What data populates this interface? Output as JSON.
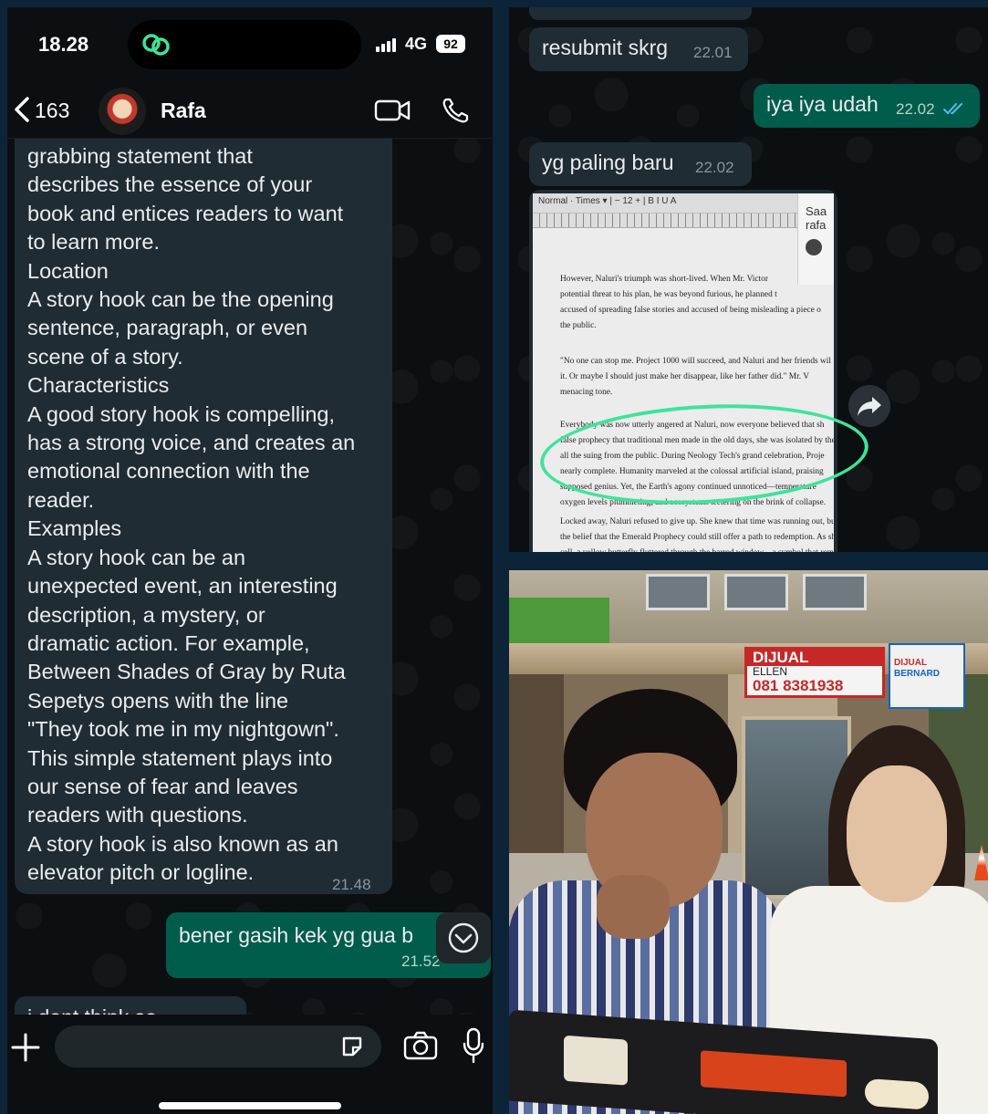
{
  "status_bar": {
    "time": "18.28",
    "network": "4G",
    "battery": "92"
  },
  "header": {
    "back_count": "163",
    "contact_name": "Rafa"
  },
  "messages_left": {
    "long_text_lines": [
      "grabbing statement that",
      "describes the essence of your",
      "book and entices readers to want",
      "to learn more.",
      "Location",
      "A story hook can be the opening",
      "sentence, paragraph, or even",
      "scene of a story.",
      "Characteristics",
      "A good story hook is compelling,",
      "has a strong voice, and creates an",
      "emotional connection with the",
      "reader.",
      "Examples",
      "A story hook can be an",
      "unexpected event, an interesting",
      "description, a mystery, or",
      "dramatic action. For example,",
      "Between Shades of Gray by Ruta",
      "Sepetys opens with the line",
      "\"They took me in my nightgown\".",
      "This simple statement plays into",
      "our sense of fear and leaves",
      "readers with questions.",
      "A story hook is also known as an",
      "elevator pitch or logline."
    ],
    "long_text_time": "21.48",
    "outgoing_text": "bener gasih kek yg gua b",
    "outgoing_time": "21.52",
    "partial_incoming": "i dont think so"
  },
  "messages_right": {
    "m1_text": "resubmit skrg",
    "m1_time": "22.01",
    "m2_text": "iya iya udah",
    "m2_time": "22.02",
    "m3_text": "yg paling baru",
    "m3_time": "22.02"
  },
  "document_screenshot": {
    "toolbar": "Normal · Times ▾ | − 12 + | B I U A",
    "side_panel": [
      "Saa",
      "rafa"
    ],
    "para1": [
      "However, Naluri's triumph was short-lived. When Mr. Victor",
      "potential threat to his plan, he was beyond furious, he planned t",
      "accused of spreading false stories and accused of being misleading a piece o",
      "the public."
    ],
    "para2": [
      "\"No one can stop me. Project 1000 will succeed, and Naluri and her friends wil",
      "it. Or maybe I should just make her disappear, like her father did.\" Mr. V",
      "menacing tone."
    ],
    "para3": [
      "Everybody was now utterly angered at Naluri, now everyone believed that sh",
      "false prophecy that traditional men made in the old days, she was isolated by the",
      "all the suing from the public. During Neology Tech's grand celebration, Proje",
      "nearly complete. Humanity marveled at the colossal artificial island, praising",
      "supposed genius. Yet, the Earth's agony continued unnoticed—temperature",
      "oxygen levels plummeting, and ecosystems teetering on the brink of collapse."
    ],
    "para4": [
      "Locked away, Naluri refused to give up. She knew that time was running out, but s",
      "the belief that the Emerald Prophecy could still offer a path to redemption. As sh",
      "cell, a yellow butterfly fluttered through the barred window—a symbol that remai"
    ]
  },
  "photo": {
    "sign_red_title": "DIJUAL",
    "sign_red_name": "ELLEN",
    "sign_red_phone": "081 8381938",
    "sign_blue_title": "DIJUAL",
    "sign_blue_name": "BERNARD"
  },
  "colors": {
    "bubble_in": "#202c33",
    "bubble_out": "#005c4b",
    "accent_green": "#3fe39a",
    "background": "#0d2438"
  }
}
